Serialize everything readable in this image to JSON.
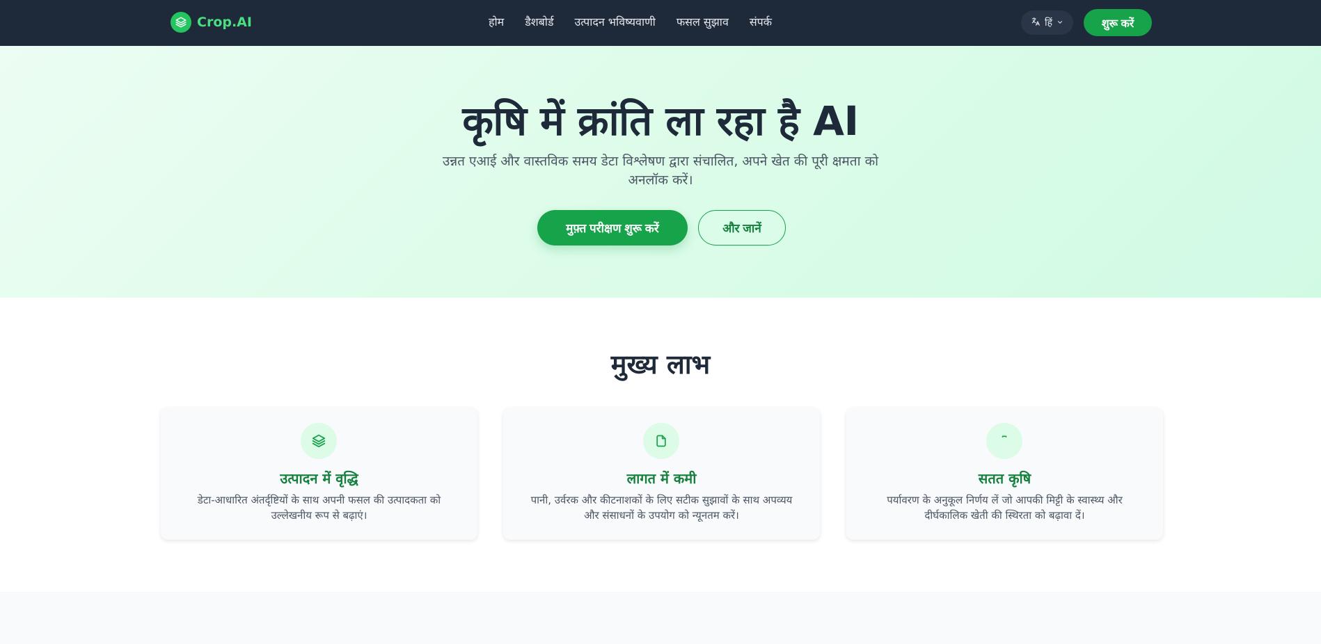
{
  "nav": {
    "brand": "Crop.AI",
    "links": [
      "होम",
      "डैशबोर्ड",
      "उत्पादन भविष्यवाणी",
      "फसल सुझाव",
      "संपर्क"
    ],
    "language": "हिं",
    "cta": "शुरू करें"
  },
  "hero": {
    "title": "कृषि में क्रांति ला रहा है AI",
    "subtitle": "उन्नत एआई और वास्तविक समय डेटा विश्लेषण द्वारा संचालित, अपने खेत की पूरी क्षमता को अनलॉक करें।",
    "primary_button": "मुफ़्त परीक्षण शुरू करें",
    "secondary_button": "और जानें"
  },
  "benefits": {
    "title": "मुख्य लाभ",
    "cards": [
      {
        "icon": "layers-icon",
        "title": "उत्पादन में वृद्धि",
        "description": "डेटा-आधारित अंतर्दृष्टियों के साथ अपनी फसल की उत्पादकता को उल्लेखनीय रूप से बढ़ाएं।"
      },
      {
        "icon": "document-icon",
        "title": "लागत में कमी",
        "description": "पानी, उर्वरक और कीटनाशकों के लिए सटीक सुझावों के साथ अपव्यय और संसाधनों के उपयोग को न्यूनतम करें।"
      },
      {
        "icon": "leaf-icon",
        "title": "सतत कृषि",
        "description": "पर्यावरण के अनुकूल निर्णय लें जो आपकी मिट्टी के स्वास्थ्य और दीर्घकालिक खेती की स्थिरता को बढ़ावा दें।"
      }
    ]
  },
  "colors": {
    "navbar": "#1e2939",
    "accent": "#16a34a",
    "brand": "#4ade80",
    "card_title": "#15803d",
    "hero_bg": "#dcfce9"
  }
}
